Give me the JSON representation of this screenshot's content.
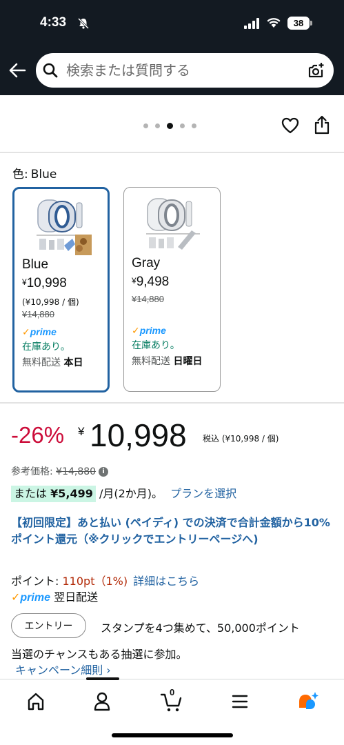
{
  "status_bar": {
    "time": "4:33",
    "battery": "38"
  },
  "search": {
    "placeholder": "検索または質問する"
  },
  "carousel": {
    "dot_count": 5,
    "active_index": 2
  },
  "variation": {
    "label": "色:",
    "selected": "Blue",
    "options": [
      {
        "name": "Blue",
        "currency": "¥",
        "price": "10,998",
        "unit_price": "(¥10,998 / 個)",
        "list_price": "¥14,880",
        "prime": "prime",
        "stock": "在庫あり。",
        "shipping_label": "無料配送",
        "shipping_day": "本日"
      },
      {
        "name": "Gray",
        "currency": "¥",
        "price": "9,498",
        "list_price": "¥14,880",
        "prime": "prime",
        "stock": "在庫あり。",
        "shipping_label": "無料配送",
        "shipping_day": "日曜日"
      }
    ]
  },
  "pricing": {
    "discount": "-26%",
    "currency": "¥",
    "price": "10,998",
    "tax_note": "税込 (¥10,998 / 個)",
    "reference_label": "参考価格:",
    "reference_price": "¥14,880",
    "install_prefix": "または",
    "install_amount": "¥5,499",
    "install_suffix": "/月(2か月)。",
    "install_link": "プランを選択"
  },
  "promo": {
    "text": "【初回限定】あと払い (ペイディ) での決済で合計金額から10%ポイント還元（※クリックでエントリーページへ)"
  },
  "points": {
    "label": "ポイント:",
    "value": "110pt（1%)",
    "details_link": "詳細はこちら"
  },
  "prime_shipping": {
    "prime": "prime",
    "text": "翌日配送"
  },
  "campaign": {
    "entry_button": "エントリー",
    "text_line1": "スタンプを4つ集めて、50,000ポイント",
    "text_line2": "当選のチャンスもある抽選に参加。",
    "details_link": "キャンペーン細則 ›"
  },
  "bottom_nav": {
    "items": [
      "home-icon",
      "account-icon",
      "cart-icon",
      "menu-icon",
      "rufus-icon"
    ],
    "cart_count": "0"
  },
  "colors": {
    "header_bg": "#131a22",
    "link": "#2162a1",
    "deal_red": "#cc0c39",
    "stock_green": "#067d62",
    "prime_blue": "#1a98ff",
    "selected_border": "#2162a1"
  }
}
